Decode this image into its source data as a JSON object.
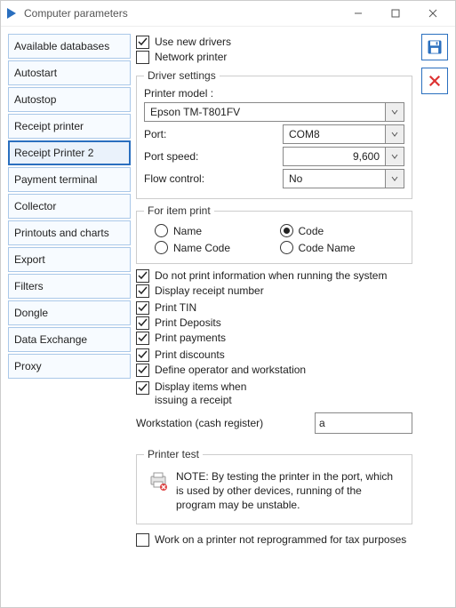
{
  "window": {
    "title": "Computer parameters"
  },
  "sidebar": {
    "items": [
      {
        "label": "Available databases"
      },
      {
        "label": "Autostart"
      },
      {
        "label": "Autostop"
      },
      {
        "label": "Receipt printer"
      },
      {
        "label": "Receipt Printer 2"
      },
      {
        "label": "Payment terminal"
      },
      {
        "label": "Collector"
      },
      {
        "label": "Printouts and charts"
      },
      {
        "label": "Export"
      },
      {
        "label": "Filters"
      },
      {
        "label": "Dongle"
      },
      {
        "label": "Data Exchange"
      },
      {
        "label": "Proxy"
      }
    ],
    "selected_index": 4
  },
  "top_checks": {
    "use_new_drivers": {
      "label": "Use new drivers",
      "checked": true
    },
    "network_printer": {
      "label": "Network printer",
      "checked": false
    }
  },
  "driver": {
    "legend": "Driver settings",
    "printer_model_label": "Printer model :",
    "printer_model_value": "Epson TM-T801FV",
    "port_label": "Port:",
    "port_value": "COM8",
    "port_speed_label": "Port speed:",
    "port_speed_value": "9,600",
    "flow_label": "Flow control:",
    "flow_value": "No"
  },
  "item_print": {
    "legend": "For item print",
    "options": [
      {
        "label": "Name",
        "selected": false
      },
      {
        "label": "Code",
        "selected": true
      },
      {
        "label": "Name Code",
        "selected": false
      },
      {
        "label": "Code Name",
        "selected": false
      }
    ]
  },
  "checks": {
    "no_info": {
      "label": "Do not print information when running the system",
      "checked": true
    },
    "receipt_number": {
      "label": "Display receipt number",
      "checked": true
    },
    "print_tin": {
      "label": "Print TIN",
      "checked": true
    },
    "print_deposits": {
      "label": "Print Deposits",
      "checked": true
    },
    "print_payments": {
      "label": "Print payments",
      "checked": true
    },
    "print_discounts": {
      "label": "Print discounts",
      "checked": true
    },
    "define_op": {
      "label": "Define operator and workstation",
      "checked": true
    },
    "display_items_l1": "Display items when",
    "display_items_l2": "issuing a receipt",
    "display_items_checked": true
  },
  "workstation": {
    "label": "Workstation (cash register)",
    "value": "a"
  },
  "printer_test": {
    "legend": "Printer test",
    "note": "NOTE: By testing the printer in the port, which is used by other devices, running of the program may be unstable."
  },
  "bottom_check": {
    "label": "Work on a printer not reprogrammed for tax purposes",
    "checked": false
  }
}
